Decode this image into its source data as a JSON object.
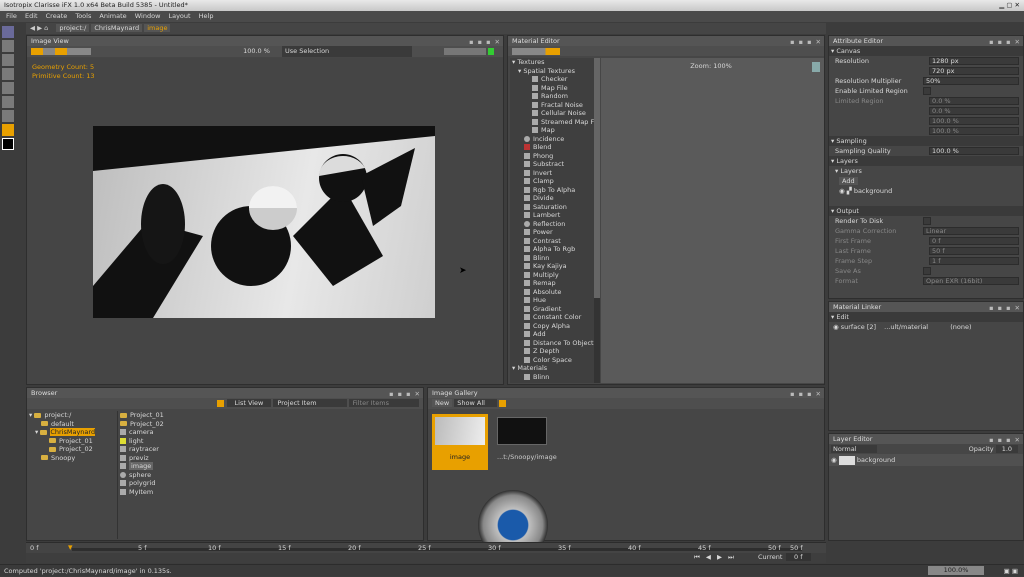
{
  "window": {
    "title": "Isotropix Clarisse iFX 1.0 x64 Beta Build 5385 - Untitled*"
  },
  "menu": [
    "File",
    "Edit",
    "Create",
    "Tools",
    "Animate",
    "Window",
    "Layout",
    "Help"
  ],
  "breadcrumb": [
    "project:/",
    "ChrisMaynard",
    "image"
  ],
  "image_view": {
    "title": "Image View",
    "zoom": "100.0 %",
    "mode": "Use Selection",
    "geometry_count": "Geometry Count: 5",
    "primitive_count": "Primitive Count: 13"
  },
  "material_editor": {
    "title": "Material Editor",
    "zoom": "Zoom: 100%",
    "textures_label": "Textures",
    "spatial_label": "Spatial Textures",
    "spatial_items": [
      "Checker",
      "Map File",
      "Random",
      "Fractal Noise",
      "Cellular Noise",
      "Streamed Map F",
      "Map"
    ],
    "items": [
      "Incidence",
      "Blend",
      "Phong",
      "Substract",
      "Invert",
      "Clamp",
      "Rgb To Alpha",
      "Divide",
      "Saturation",
      "Lambert",
      "Reflection",
      "Power",
      "Contrast",
      "Alpha To Rgb",
      "Blinn",
      "Kay Kajiya",
      "Multiply",
      "Remap",
      "Absolute",
      "Hue",
      "Gradient",
      "Constant Color",
      "Copy Alpha",
      "Add",
      "Distance To Object",
      "Z Depth",
      "Color Space"
    ],
    "materials_label": "Materials",
    "materials_items": [
      "Blinn"
    ]
  },
  "attribute_editor": {
    "title": "Attribute Editor",
    "canvas": "Canvas",
    "resolution_label": "Resolution",
    "res_w": "1280 px",
    "res_h": "720 px",
    "res_mult_label": "Resolution Multiplier",
    "res_mult": "50%",
    "limited_label": "Enable Limited Region",
    "limited_region_label": "Limited Region",
    "lr": [
      "0.0 %",
      "0.0 %",
      "100.0 %",
      "100.0 %"
    ],
    "sampling": "Sampling",
    "sampling_quality_label": "Sampling Quality",
    "sampling_quality": "100.0 %",
    "layers": "Layers",
    "layers_sub": "Layers",
    "add": "Add",
    "layer_name": "background",
    "output": "Output",
    "render_to_disk": "Render To Disk",
    "gamma_label": "Gamma Correction",
    "gamma": "Linear",
    "first_frame_label": "First Frame",
    "first_frame": "0 f",
    "last_frame_label": "Last Frame",
    "last_frame": "50 f",
    "frame_step_label": "Frame Step",
    "frame_step": "1 f",
    "save_as_label": "Save As",
    "format_label": "Format",
    "format": "Open EXR (16bit)"
  },
  "material_linker": {
    "title": "Material Linker",
    "edit": "Edit",
    "row_a": "surface [2]",
    "row_b": "...ult/material",
    "row_c": "(none)"
  },
  "layer_editor": {
    "title": "Layer Editor",
    "blend": "Normal",
    "opacity_label": "Opacity",
    "opacity": "1.0",
    "layer": "background"
  },
  "browser": {
    "title": "Browser",
    "view": "List View",
    "filter_type": "Project Item",
    "filter_placeholder": "Filter Items",
    "tree": [
      "project:/",
      "default",
      "ChrisMaynard",
      "Project_01",
      "Project_02",
      "Snoopy"
    ],
    "list": [
      "Project_01",
      "Project_02",
      "camera",
      "light",
      "raytracer",
      "previz",
      "image",
      "sphere",
      "polygrid",
      "MyItem"
    ]
  },
  "image_gallery": {
    "title": "Image Gallery",
    "new": "New",
    "show": "Show All",
    "thumb1": "image",
    "thumb2": "...t:/Snoopy/image"
  },
  "timeline": {
    "start": "0 f",
    "ticks": [
      "5 f",
      "10 f",
      "15 f",
      "20 f",
      "25 f",
      "30 f",
      "35 f",
      "40 f",
      "45 f",
      "50 f"
    ],
    "end": "50 f",
    "current_label": "Current",
    "current": "0 f"
  },
  "status": {
    "message": "Computed 'project:/ChrisMaynard/image' in 0.135s.",
    "progress": "100.0%"
  },
  "colors": {
    "accent": "#e8a000",
    "panel": "#464646",
    "viewport": "#5a5a5a"
  }
}
